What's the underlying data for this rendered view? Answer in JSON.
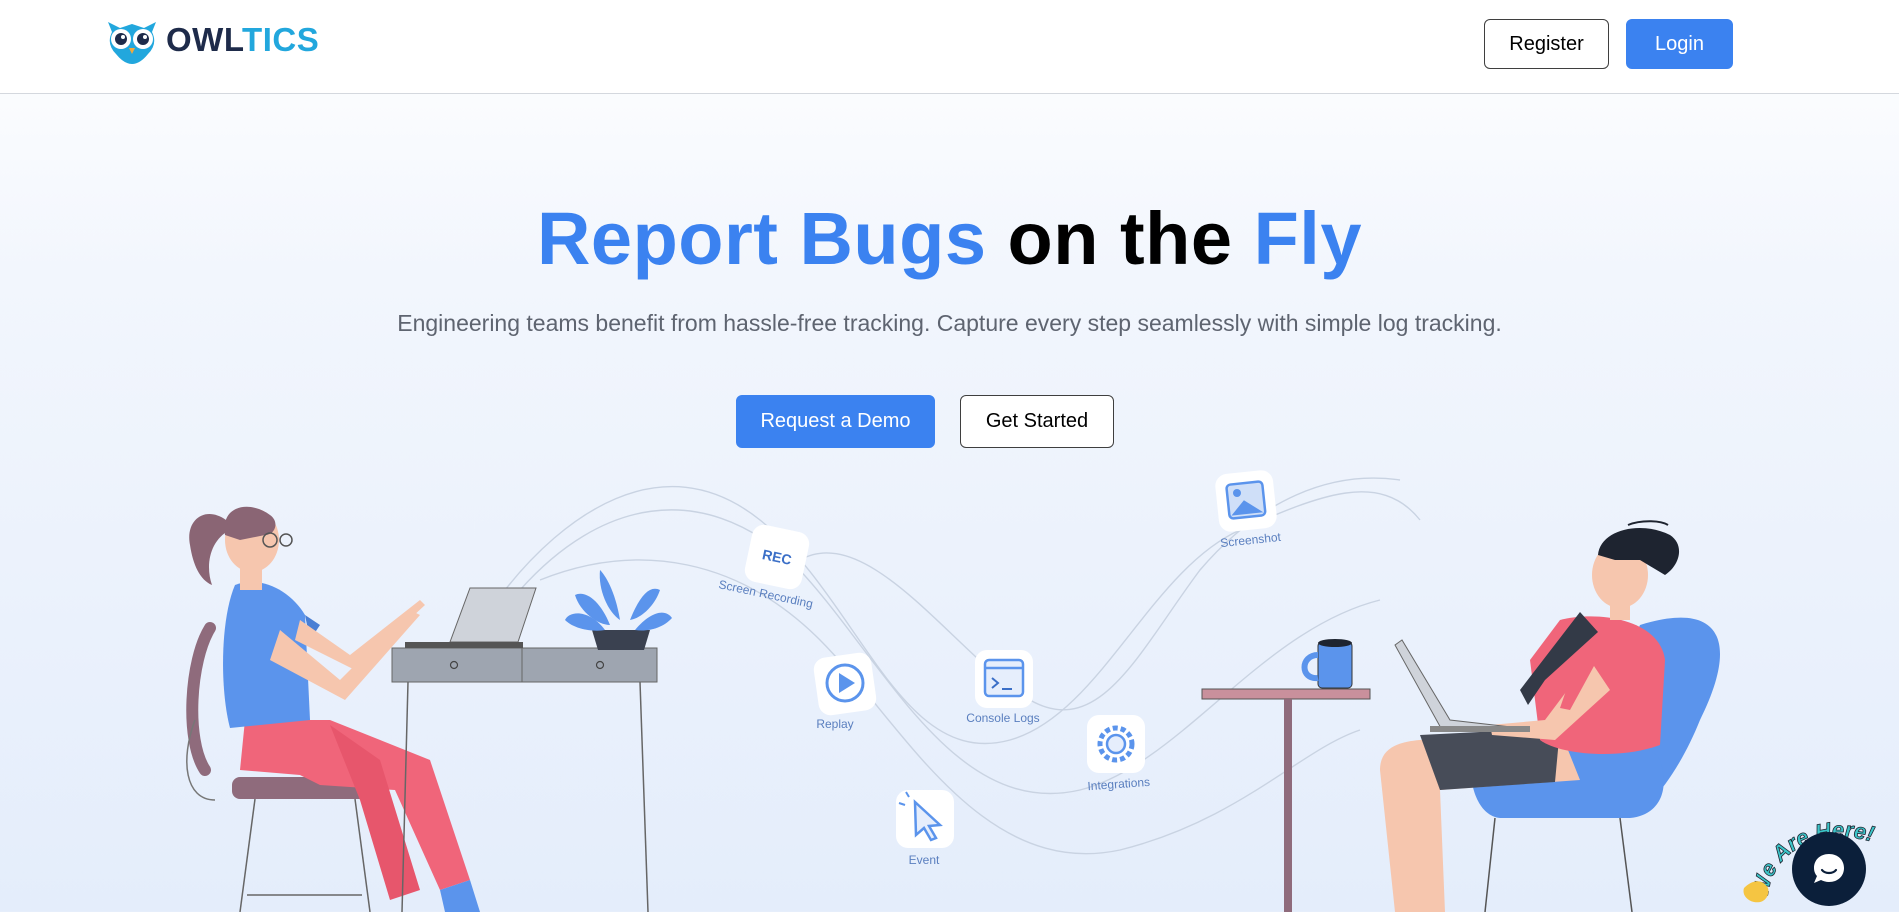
{
  "header": {
    "logo_part1": "OWL",
    "logo_part2": "TICS",
    "register_label": "Register",
    "login_label": "Login"
  },
  "hero": {
    "title_word1": "Report Bugs",
    "title_word2": "on the",
    "title_word3": "Fly",
    "subtitle": "Engineering teams benefit from hassle-free tracking. Capture every step seamlessly with simple log tracking.",
    "demo_label": "Request a Demo",
    "started_label": "Get Started"
  },
  "features": {
    "screen_recording": "Screen Recording",
    "rec_badge": "REC",
    "replay": "Replay",
    "console_logs": "Console Logs",
    "event": "Event",
    "integrations": "Integrations",
    "screenshot": "Screenshot"
  },
  "chat": {
    "badge_text": "We Are Here!"
  },
  "colors": {
    "accent": "#3b82f0",
    "logo_dark": "#1e2b4a",
    "logo_light": "#22a7dd",
    "chat_bg": "#0b1f3a"
  }
}
